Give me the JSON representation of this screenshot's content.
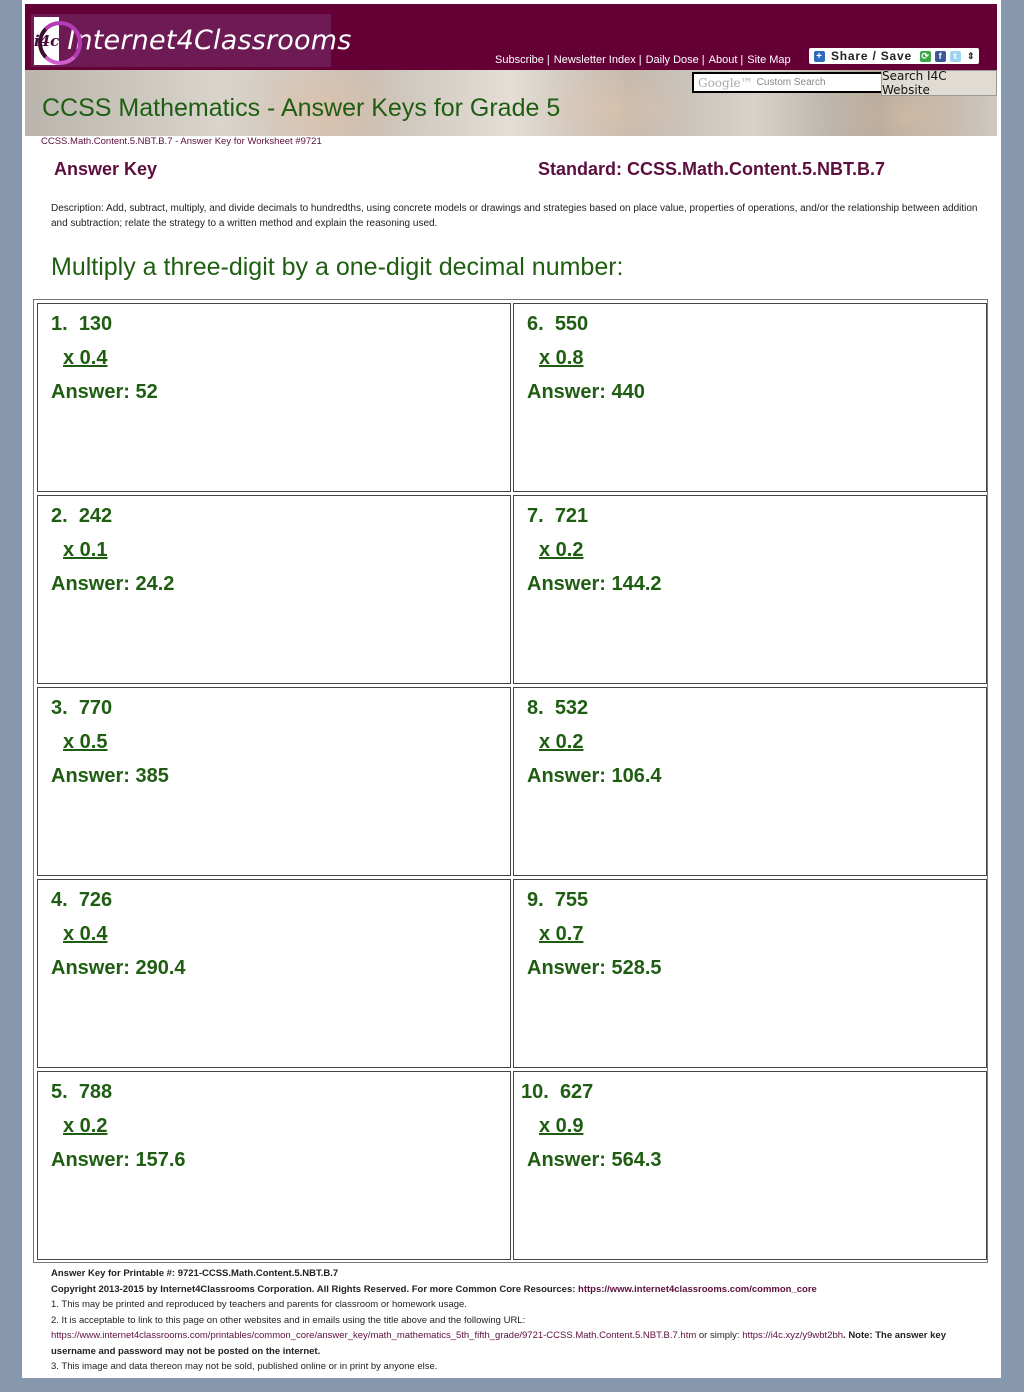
{
  "header": {
    "logo_mark": "i4c",
    "logo_text": "Internet4Classrooms",
    "nav": [
      "Subscribe",
      "Newsletter Index",
      "Daily Dose",
      "About",
      "Site Map"
    ],
    "share_label": "Share / Save",
    "search_placeholder": "Custom Search",
    "search_brand": "Google™",
    "search_button": "Search I4C Website"
  },
  "banner": {
    "title": "CCSS Mathematics - Answer Keys for Grade 5"
  },
  "breadcrumb": "CCSS.Math.Content.5.NBT.B.7 - Answer Key for Worksheet #9721",
  "answer_key_title": "Answer Key",
  "standard_title": "Standard: CCSS.Math.Content.5.NBT.B.7",
  "description": "Description: Add, subtract, multiply, and divide decimals to hundredths, using concrete models or drawings and strategies based on place value, properties of operations, and/or the relationship between addition and subtraction; relate the strategy to a written method and explain the reasoning used.",
  "instruction": "Multiply a three-digit by a one-digit decimal number:",
  "problems": [
    {
      "number": "1.",
      "value": "130",
      "multiplier": "x 0.4",
      "answer": "Answer: 52"
    },
    {
      "number": "2.",
      "value": "242",
      "multiplier": "x 0.1",
      "answer": "Answer: 24.2"
    },
    {
      "number": "3.",
      "value": "770",
      "multiplier": "x 0.5",
      "answer": "Answer: 385"
    },
    {
      "number": "4.",
      "value": "726",
      "multiplier": "x 0.4",
      "answer": "Answer: 290.4"
    },
    {
      "number": "5.",
      "value": "788",
      "multiplier": "x 0.2",
      "answer": "Answer: 157.6"
    },
    {
      "number": "6.",
      "value": "550",
      "multiplier": "x 0.8",
      "answer": "Answer: 440"
    },
    {
      "number": "7.",
      "value": "721",
      "multiplier": "x 0.2",
      "answer": "Answer: 144.2"
    },
    {
      "number": "8.",
      "value": "532",
      "multiplier": "x 0.2",
      "answer": "Answer: 106.4"
    },
    {
      "number": "9.",
      "value": "755",
      "multiplier": "x 0.7",
      "answer": "Answer: 528.5"
    },
    {
      "number": "10.",
      "value": "627",
      "multiplier": "x 0.9",
      "answer": "Answer: 564.3"
    }
  ],
  "footer": {
    "printable": "Answer Key for Printable #: 9721-CCSS.Math.Content.5.NBT.B.7",
    "copyright": "Copyright 2013-2015 by Internet4Classrooms Corporation. All Rights Reserved. For more Common Core Resources: ",
    "copyright_link": "https://www.internet4classrooms.com/common_core",
    "rule1": "1. This may be printed and reproduced by teachers and parents for classroom or homework usage.",
    "rule2": "2. It is acceptable to link to this page on other websites and in emails using the title above and the following URL:",
    "rule2_link": "https://www.internet4classrooms.com/printables/common_core/answer_key/math_mathematics_5th_fifth_grade/9721-CCSS.Math.Content.5.NBT.B.7.htm",
    "rule2_or": " or simply: ",
    "rule2_short_link": "https://i4c.xyz/y9wbt2bh",
    "rule2_note": ". Note: The answer key username and password may not be posted on the internet.",
    "rule3": "3. This image and data thereon may not be sold, published online or in print by anyone else."
  },
  "colors": {
    "brand": "#650036",
    "heading": "#5c0f3e",
    "green": "#1f5e12",
    "background": "#8797ad"
  }
}
